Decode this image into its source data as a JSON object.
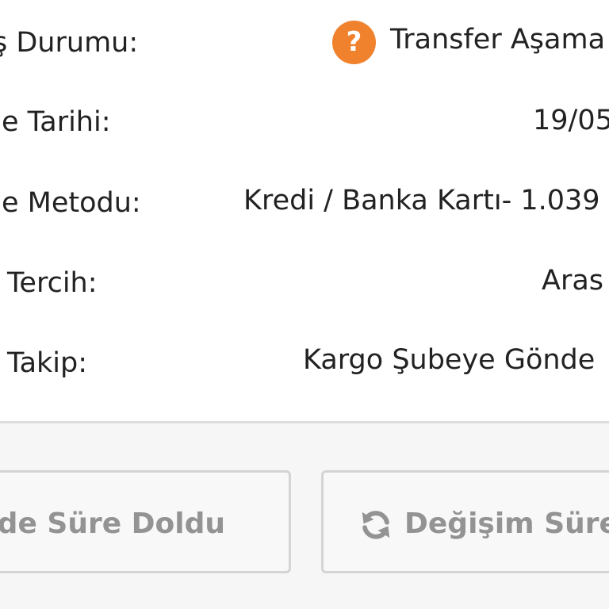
{
  "order_details": {
    "rows": [
      {
        "label": "ş Durumu:",
        "value": "Transfer Aşama",
        "icon": "question-mark-icon"
      },
      {
        "label": "e Tarihi:",
        "value": "19/05"
      },
      {
        "label": "e Metodu:",
        "value": "Kredi / Banka Kartı- 1.039"
      },
      {
        "label": "Tercih:",
        "value": "Aras"
      },
      {
        "label": "Takip:",
        "value": "Kargo Şubeye Gönde"
      }
    ]
  },
  "actions": {
    "return_label": "ade Süre Doldu",
    "exchange_label": "Değişim Süre",
    "exchange_icon": "refresh-icon"
  },
  "colors": {
    "status_icon": "#f0822e",
    "button_text": "#939393",
    "action_background": "#f6f6f6",
    "divider": "#dddddd"
  }
}
